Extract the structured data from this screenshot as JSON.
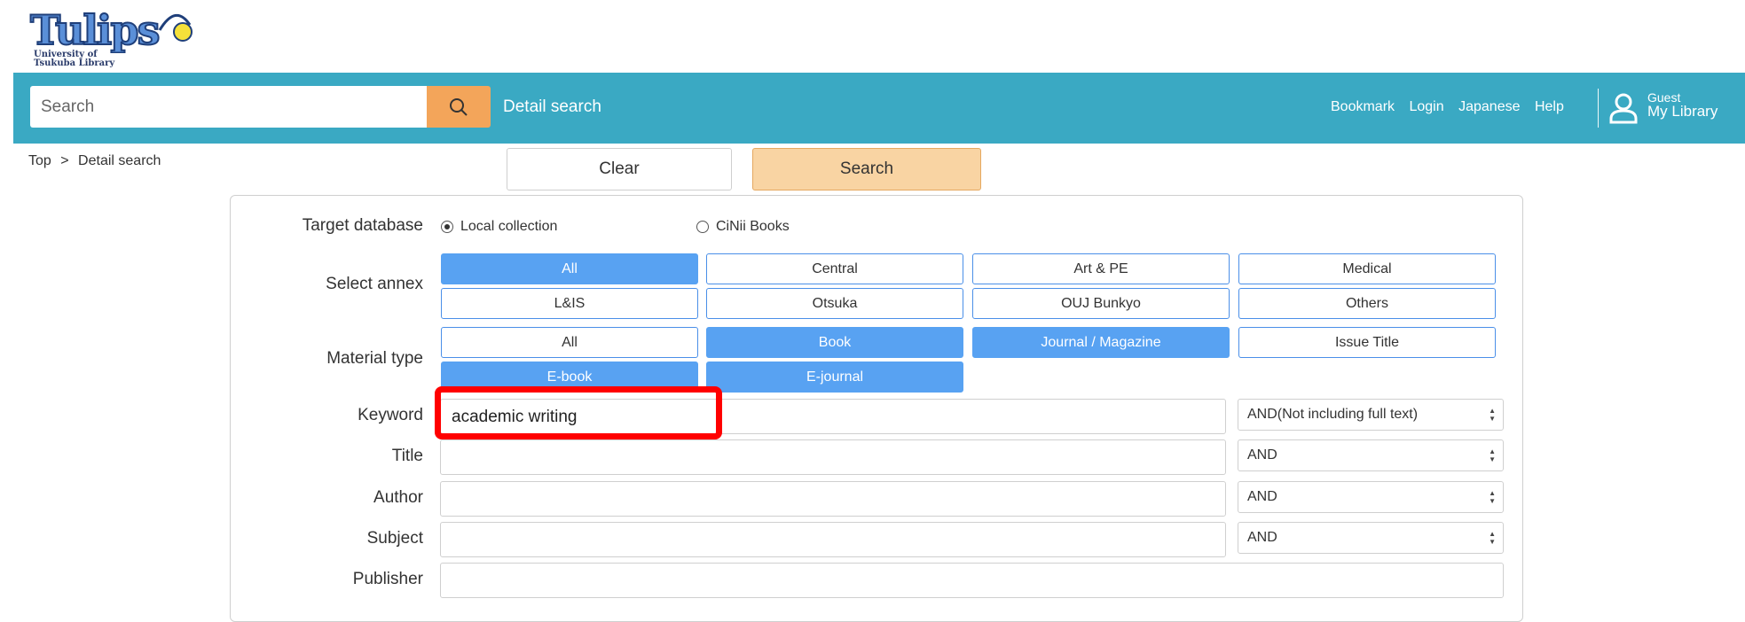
{
  "logo": {
    "text": "Tulips",
    "subtitle_line1": "University of",
    "subtitle_line2": "Tsukuba Library"
  },
  "header": {
    "search_placeholder": "Search",
    "detail_search": "Detail search",
    "links": [
      "Bookmark",
      "Login",
      "Japanese",
      "Help"
    ],
    "guest": "Guest",
    "my_library": "My Library",
    "colors": {
      "bar": "#3aa9c3",
      "search_button": "#f3a55a"
    }
  },
  "breadcrumb": {
    "top": "Top",
    "separator": ">",
    "current": "Detail search"
  },
  "actions": {
    "clear": "Clear",
    "search": "Search"
  },
  "form": {
    "target_database": {
      "label": "Target database",
      "options": [
        "Local collection",
        "CiNii Books"
      ],
      "selected": "Local collection"
    },
    "select_annex": {
      "label": "Select annex",
      "options": [
        "All",
        "Central",
        "Art & PE",
        "Medical",
        "L&IS",
        "Otsuka",
        "OUJ Bunkyo",
        "Others"
      ],
      "selected": [
        "All"
      ]
    },
    "material_type": {
      "label": "Material type",
      "options": [
        "All",
        "Book",
        "Journal / Magazine",
        "Issue Title",
        "E-book",
        "E-journal"
      ],
      "selected": [
        "Book",
        "Journal / Magazine",
        "E-book",
        "E-journal"
      ]
    },
    "keyword": {
      "label": "Keyword",
      "value": "academic writing",
      "operator": "AND(Not including full text)"
    },
    "title": {
      "label": "Title",
      "value": "",
      "operator": "AND"
    },
    "author": {
      "label": "Author",
      "value": "",
      "operator": "AND"
    },
    "subject": {
      "label": "Subject",
      "value": "",
      "operator": "AND"
    },
    "publisher": {
      "label": "Publisher",
      "value": ""
    }
  }
}
